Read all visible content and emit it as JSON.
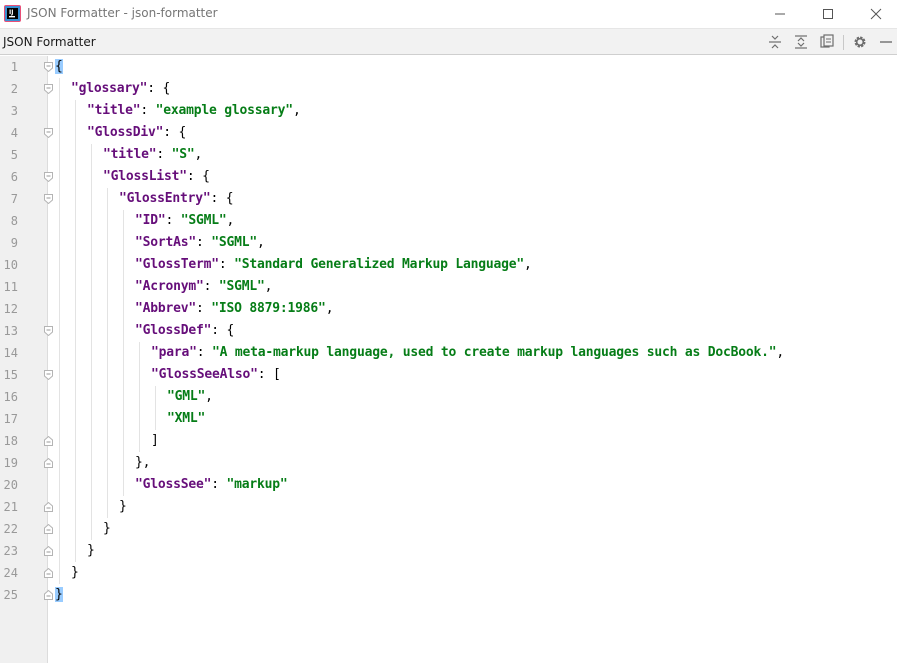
{
  "window": {
    "title": "JSON Formatter - json-formatter",
    "minimize_icon": "minimize-icon",
    "maximize_icon": "maximize-icon",
    "close_icon": "close-icon",
    "app_icon": "intellij-app-icon"
  },
  "toolwindow": {
    "title": "JSON Formatter",
    "actions": [
      {
        "name": "collapse-all",
        "icon": "collapse-all-icon"
      },
      {
        "name": "expand-all",
        "icon": "expand-all-icon"
      },
      {
        "name": "copy",
        "icon": "copy-icon"
      },
      {
        "name": "settings",
        "icon": "gear-icon"
      },
      {
        "name": "hide",
        "icon": "minimize-panel-icon"
      }
    ]
  },
  "colors": {
    "key": "#660e7a",
    "string": "#067d17",
    "punct": "#000000",
    "brace_match_bg": "#99ccff",
    "gutter_bg": "#f0f0f0",
    "line_number": "#999999"
  },
  "editor": {
    "lines": [
      {
        "n": "1",
        "indent": 0,
        "fold": "open",
        "tokens": [
          {
            "t": "{",
            "c": "match"
          }
        ]
      },
      {
        "n": "2",
        "indent": 1,
        "fold": "open",
        "tokens": [
          {
            "t": "\"glossary\"",
            "c": "key"
          },
          {
            "t": ": {",
            "c": "punct"
          }
        ]
      },
      {
        "n": "3",
        "indent": 2,
        "fold": "",
        "tokens": [
          {
            "t": "\"title\"",
            "c": "key"
          },
          {
            "t": ": ",
            "c": "punct"
          },
          {
            "t": "\"example glossary\"",
            "c": "str"
          },
          {
            "t": ",",
            "c": "punct"
          }
        ]
      },
      {
        "n": "4",
        "indent": 2,
        "fold": "open",
        "tokens": [
          {
            "t": "\"GlossDiv\"",
            "c": "key"
          },
          {
            "t": ": {",
            "c": "punct"
          }
        ]
      },
      {
        "n": "5",
        "indent": 3,
        "fold": "",
        "tokens": [
          {
            "t": "\"title\"",
            "c": "key"
          },
          {
            "t": ": ",
            "c": "punct"
          },
          {
            "t": "\"S\"",
            "c": "str"
          },
          {
            "t": ",",
            "c": "punct"
          }
        ]
      },
      {
        "n": "6",
        "indent": 3,
        "fold": "open",
        "tokens": [
          {
            "t": "\"GlossList\"",
            "c": "key"
          },
          {
            "t": ": {",
            "c": "punct"
          }
        ]
      },
      {
        "n": "7",
        "indent": 4,
        "fold": "open",
        "tokens": [
          {
            "t": "\"GlossEntry\"",
            "c": "key"
          },
          {
            "t": ": {",
            "c": "punct"
          }
        ]
      },
      {
        "n": "8",
        "indent": 5,
        "fold": "",
        "tokens": [
          {
            "t": "\"ID\"",
            "c": "key"
          },
          {
            "t": ": ",
            "c": "punct"
          },
          {
            "t": "\"SGML\"",
            "c": "str"
          },
          {
            "t": ",",
            "c": "punct"
          }
        ]
      },
      {
        "n": "9",
        "indent": 5,
        "fold": "",
        "tokens": [
          {
            "t": "\"SortAs\"",
            "c": "key"
          },
          {
            "t": ": ",
            "c": "punct"
          },
          {
            "t": "\"SGML\"",
            "c": "str"
          },
          {
            "t": ",",
            "c": "punct"
          }
        ]
      },
      {
        "n": "10",
        "indent": 5,
        "fold": "",
        "tokens": [
          {
            "t": "\"GlossTerm\"",
            "c": "key"
          },
          {
            "t": ": ",
            "c": "punct"
          },
          {
            "t": "\"Standard Generalized Markup Language\"",
            "c": "str"
          },
          {
            "t": ",",
            "c": "punct"
          }
        ]
      },
      {
        "n": "11",
        "indent": 5,
        "fold": "",
        "tokens": [
          {
            "t": "\"Acronym\"",
            "c": "key"
          },
          {
            "t": ": ",
            "c": "punct"
          },
          {
            "t": "\"SGML\"",
            "c": "str"
          },
          {
            "t": ",",
            "c": "punct"
          }
        ]
      },
      {
        "n": "12",
        "indent": 5,
        "fold": "",
        "tokens": [
          {
            "t": "\"Abbrev\"",
            "c": "key"
          },
          {
            "t": ": ",
            "c": "punct"
          },
          {
            "t": "\"ISO 8879:1986\"",
            "c": "str"
          },
          {
            "t": ",",
            "c": "punct"
          }
        ]
      },
      {
        "n": "13",
        "indent": 5,
        "fold": "open",
        "tokens": [
          {
            "t": "\"GlossDef\"",
            "c": "key"
          },
          {
            "t": ": {",
            "c": "punct"
          }
        ]
      },
      {
        "n": "14",
        "indent": 6,
        "fold": "",
        "tokens": [
          {
            "t": "\"para\"",
            "c": "key"
          },
          {
            "t": ": ",
            "c": "punct"
          },
          {
            "t": "\"A meta-markup language, used to create markup languages such as DocBook.\"",
            "c": "str"
          },
          {
            "t": ",",
            "c": "punct"
          }
        ]
      },
      {
        "n": "15",
        "indent": 6,
        "fold": "open",
        "tokens": [
          {
            "t": "\"GlossSeeAlso\"",
            "c": "key"
          },
          {
            "t": ": [",
            "c": "punct"
          }
        ]
      },
      {
        "n": "16",
        "indent": 7,
        "fold": "",
        "tokens": [
          {
            "t": "\"GML\"",
            "c": "str"
          },
          {
            "t": ",",
            "c": "punct"
          }
        ]
      },
      {
        "n": "17",
        "indent": 7,
        "fold": "",
        "tokens": [
          {
            "t": "\"XML\"",
            "c": "str"
          }
        ]
      },
      {
        "n": "18",
        "indent": 6,
        "fold": "close",
        "tokens": [
          {
            "t": "]",
            "c": "punct"
          }
        ]
      },
      {
        "n": "19",
        "indent": 5,
        "fold": "close",
        "tokens": [
          {
            "t": "},",
            "c": "punct"
          }
        ]
      },
      {
        "n": "20",
        "indent": 5,
        "fold": "",
        "tokens": [
          {
            "t": "\"GlossSee\"",
            "c": "key"
          },
          {
            "t": ": ",
            "c": "punct"
          },
          {
            "t": "\"markup\"",
            "c": "str"
          }
        ]
      },
      {
        "n": "21",
        "indent": 4,
        "fold": "close",
        "tokens": [
          {
            "t": "}",
            "c": "punct"
          }
        ]
      },
      {
        "n": "22",
        "indent": 3,
        "fold": "close",
        "tokens": [
          {
            "t": "}",
            "c": "punct"
          }
        ]
      },
      {
        "n": "23",
        "indent": 2,
        "fold": "close",
        "tokens": [
          {
            "t": "}",
            "c": "punct"
          }
        ]
      },
      {
        "n": "24",
        "indent": 1,
        "fold": "close",
        "tokens": [
          {
            "t": "}",
            "c": "punct"
          }
        ]
      },
      {
        "n": "25",
        "indent": 0,
        "fold": "close",
        "tokens": [
          {
            "t": "}",
            "c": "match"
          }
        ]
      }
    ]
  }
}
